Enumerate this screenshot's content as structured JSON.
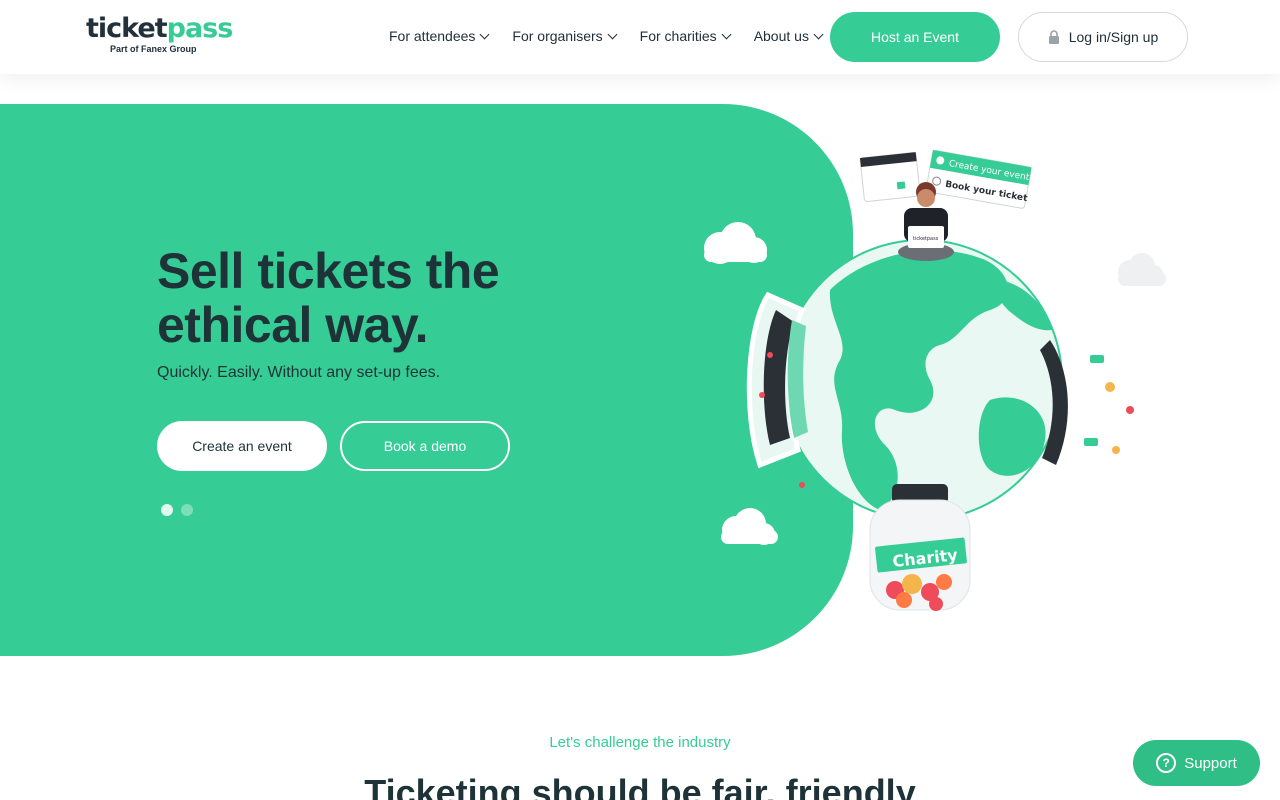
{
  "header": {
    "logo_text_1": "ticket",
    "logo_text_2": "pass",
    "logo_sub": "Part of Fanex Group",
    "nav": [
      {
        "label": "For attendees"
      },
      {
        "label": "For organisers"
      },
      {
        "label": "For charities"
      },
      {
        "label": "About us"
      }
    ],
    "host_label": "Host an Event",
    "login_label": "Log in/Sign up"
  },
  "hero": {
    "title": "Sell tickets the ethical way.",
    "subtitle": "Quickly. Easily. Without any set-up fees.",
    "create_label": "Create an event",
    "demo_label": "Book a demo",
    "slides": 2,
    "active_slide": 1,
    "illustration": {
      "card_option_1": "Create your event",
      "card_option_2": "Book your ticket",
      "jar_label": "Charity",
      "laptop_label": "ticketpass"
    }
  },
  "section": {
    "eyebrow": "Let's challenge the industry",
    "title": "Ticketing should be fair, friendly"
  },
  "support": {
    "label": "Support",
    "icon_glyph": "?"
  },
  "colors": {
    "brand_green": "#36cc95",
    "dark_text": "#1e3338"
  }
}
